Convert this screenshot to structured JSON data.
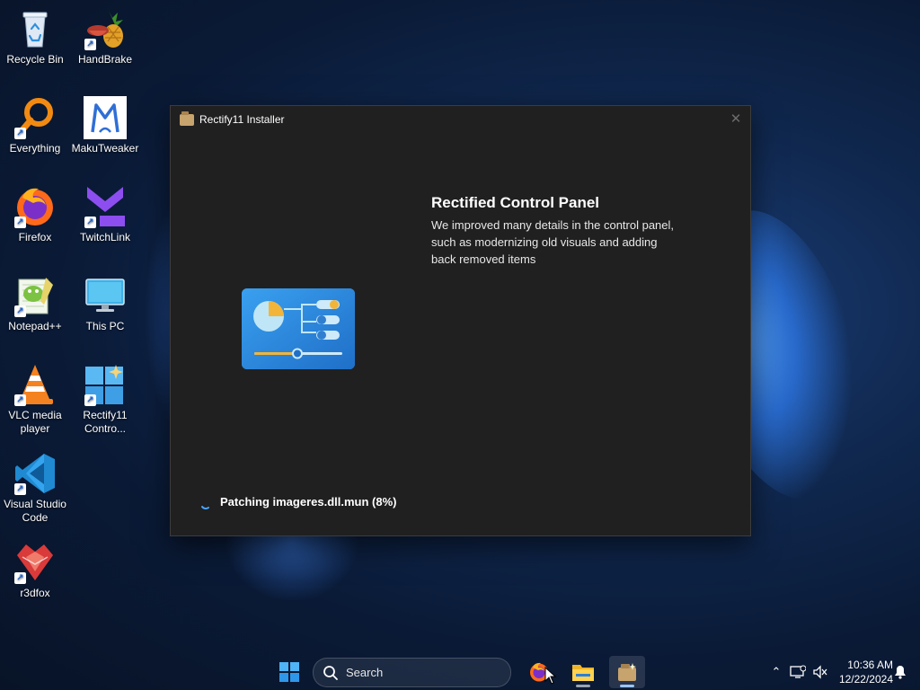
{
  "desktop": {
    "icons": [
      {
        "label": "Recycle Bin",
        "icon": "recycle-bin-icon"
      },
      {
        "label": "HandBrake",
        "icon": "handbrake-icon"
      },
      {
        "label": "Everything",
        "icon": "everything-search-icon"
      },
      {
        "label": "MakuTweaker",
        "icon": "makutweaker-icon"
      },
      {
        "label": "Firefox",
        "icon": "firefox-icon"
      },
      {
        "label": "TwitchLink",
        "icon": "twitchlink-icon"
      },
      {
        "label": "Notepad++",
        "icon": "notepad-plus-plus-icon"
      },
      {
        "label": "This PC",
        "icon": "this-pc-icon"
      },
      {
        "label": "VLC media player",
        "icon": "vlc-icon"
      },
      {
        "label": "Rectify11 Contro...",
        "icon": "rectify11-control-icon"
      },
      {
        "label": "Visual Studio Code",
        "icon": "vscode-icon"
      },
      {
        "label": "r3dfox",
        "icon": "r3dfox-icon"
      }
    ]
  },
  "installer": {
    "title": "Rectify11 Installer",
    "heading": "Rectified Control Panel",
    "description": "We improved many details in the control panel, such as modernizing old visuals and adding back removed items",
    "status": "Patching imageres.dll.mun (8%)",
    "progress_percent": 8
  },
  "taskbar": {
    "search_label": "Search",
    "apps": [
      "firefox-icon",
      "file-explorer-icon",
      "rectify11-installer-icon"
    ],
    "clock_time": "10:36 AM",
    "clock_date": "12/22/2024"
  },
  "colors": {
    "window_bg": "#202020",
    "accent": "#9ac4f8",
    "wallpaper": "#0a1a36"
  }
}
